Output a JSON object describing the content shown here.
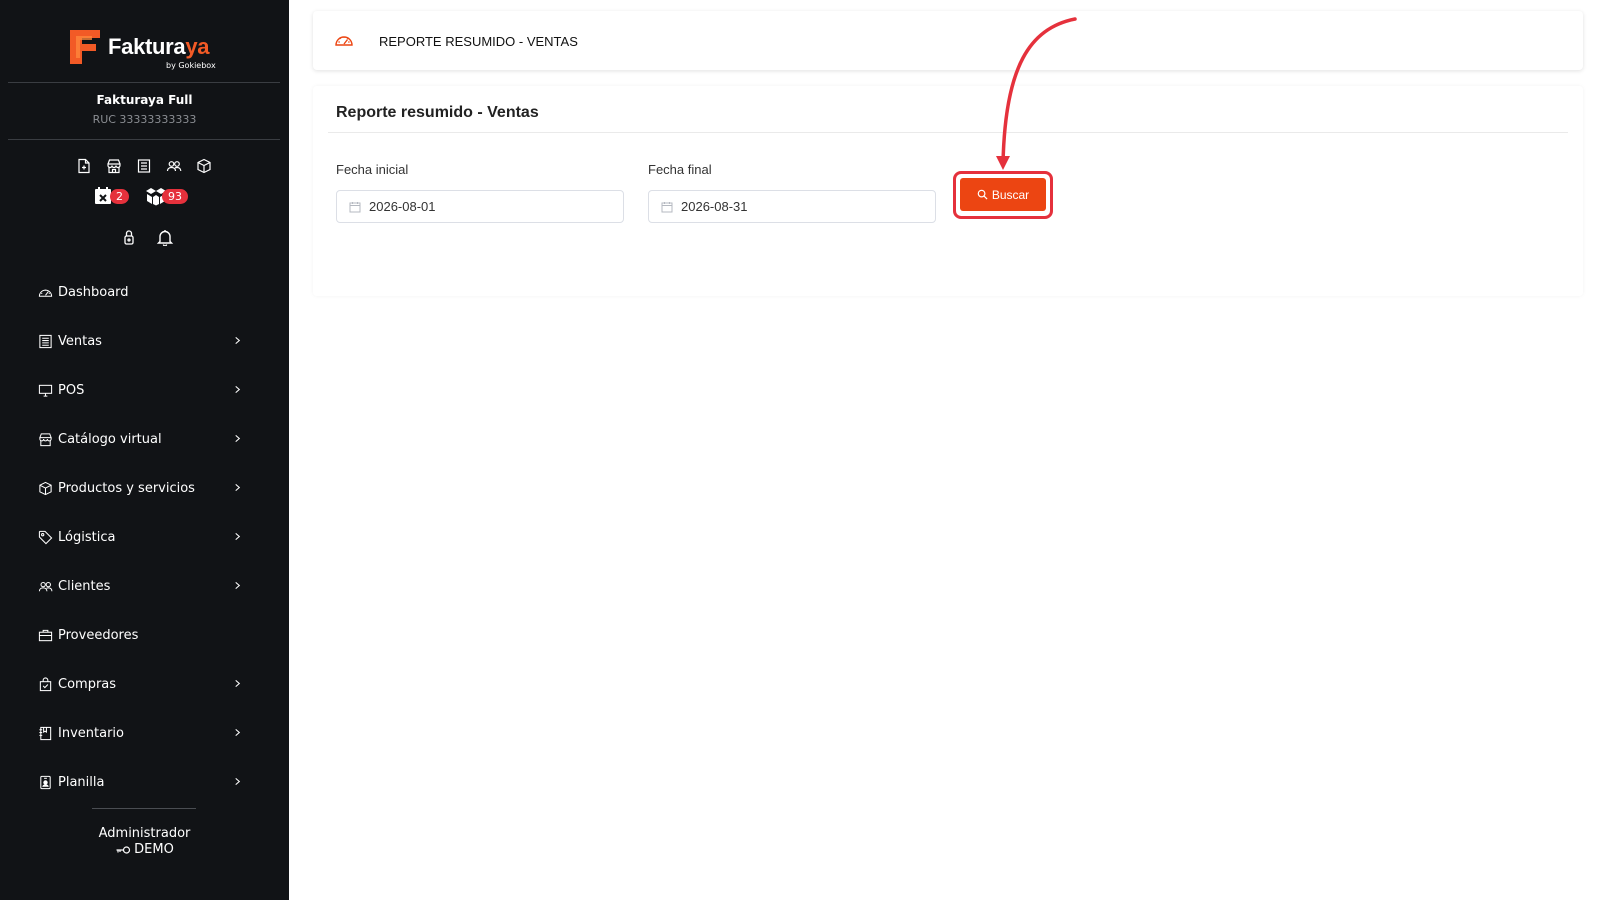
{
  "brand": {
    "name_part1": "Faktura",
    "name_part2": "ya",
    "tagline": "by Gokiebox",
    "accent_color": "#f25a26"
  },
  "company": {
    "name": "Fakturaya Full",
    "ruc": "RUC 33333333333"
  },
  "quick_icons": [
    "new-document-icon",
    "store-icon",
    "receipt-list-icon",
    "users-icon",
    "box-icon"
  ],
  "badges": [
    {
      "icon": "calendar-x-icon",
      "count": "2"
    },
    {
      "icon": "boxes-icon",
      "count": "93"
    }
  ],
  "utility_icons": [
    "lock-icon",
    "bell-icon"
  ],
  "sidebar": {
    "items": [
      {
        "label": "Dashboard",
        "icon": "speedometer-icon",
        "has_submenu": false
      },
      {
        "label": "Ventas",
        "icon": "receipt-icon",
        "has_submenu": true
      },
      {
        "label": "POS",
        "icon": "monitor-icon",
        "has_submenu": true
      },
      {
        "label": "Catálogo virtual",
        "icon": "store-icon",
        "has_submenu": true
      },
      {
        "label": "Productos y servicios",
        "icon": "box-icon",
        "has_submenu": true
      },
      {
        "label": "Lógistica",
        "icon": "tag-icon",
        "has_submenu": true
      },
      {
        "label": "Clientes",
        "icon": "users-icon",
        "has_submenu": true
      },
      {
        "label": "Proveedores",
        "icon": "briefcase-icon",
        "has_submenu": false
      },
      {
        "label": "Compras",
        "icon": "bag-check-icon",
        "has_submenu": true
      },
      {
        "label": "Inventario",
        "icon": "journal-icon",
        "has_submenu": true
      },
      {
        "label": "Planilla",
        "icon": "person-badge-icon",
        "has_submenu": true
      }
    ]
  },
  "user": {
    "role": "Administrador",
    "name": "DEMO"
  },
  "header": {
    "title": "REPORTE RESUMIDO - VENTAS",
    "icon": "speedometer-icon"
  },
  "report": {
    "title": "Reporte resumido - Ventas",
    "start_label": "Fecha inicial",
    "start_value": "2026-08-01",
    "end_label": "Fecha final",
    "end_value": "2026-08-31",
    "search_label": "Buscar",
    "button_color": "#ec4512",
    "highlight_color": "#e5313c"
  }
}
